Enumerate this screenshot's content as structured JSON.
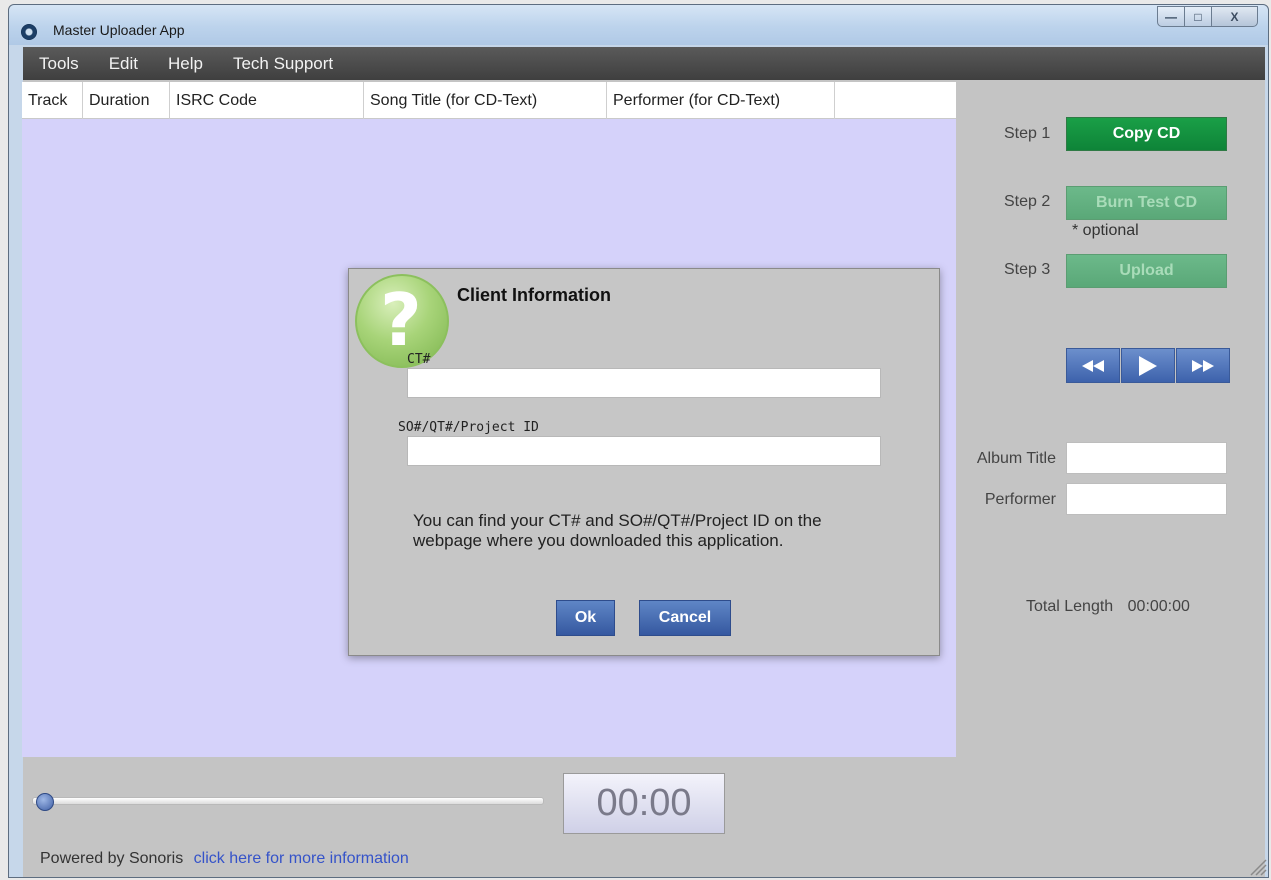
{
  "window": {
    "title": "Master Uploader App",
    "controls": {
      "minimize": "—",
      "maximize": "□",
      "close": "X"
    }
  },
  "menu": [
    "Tools",
    "Edit",
    "Help",
    "Tech Support"
  ],
  "table": {
    "columns": [
      "Track",
      "Duration",
      "ISRC Code",
      "Song Title (for CD-Text)",
      "Performer (for CD-Text)",
      ""
    ],
    "rows": []
  },
  "steps": [
    {
      "label": "Step 1",
      "button": "Copy CD",
      "enabled": true
    },
    {
      "label": "Step 2",
      "button": "Burn Test CD",
      "enabled": false,
      "note": "* optional"
    },
    {
      "label": "Step 3",
      "button": "Upload",
      "enabled": false
    }
  ],
  "transport": {
    "rewind_icon": "rewind-icon",
    "play_icon": "play-icon",
    "forward_icon": "fast-forward-icon"
  },
  "fields": {
    "album_title_label": "Album Title",
    "album_title_value": "",
    "performer_label": "Performer",
    "performer_value": ""
  },
  "total_length": {
    "label": "Total Length",
    "value": "00:00:00"
  },
  "player": {
    "time": "00:00",
    "position": 0
  },
  "footer": {
    "text": "Powered by Sonoris",
    "link": "click here for more information"
  },
  "dialog": {
    "title": "Client Information",
    "icon": "question-icon",
    "ct_label": "CT#",
    "ct_value": "",
    "so_label": "SO#/QT#/Project ID",
    "so_value": "",
    "info": "You can find your CT# and SO#/QT#/Project ID on the webpage where you downloaded this application.",
    "ok": "Ok",
    "cancel": "Cancel"
  },
  "colors": {
    "table_bg": "#d5d2fa",
    "step_active": "#13923f",
    "step_disabled": "#64b282",
    "button_blue": "#4a6fb5",
    "link": "#3553c9"
  }
}
